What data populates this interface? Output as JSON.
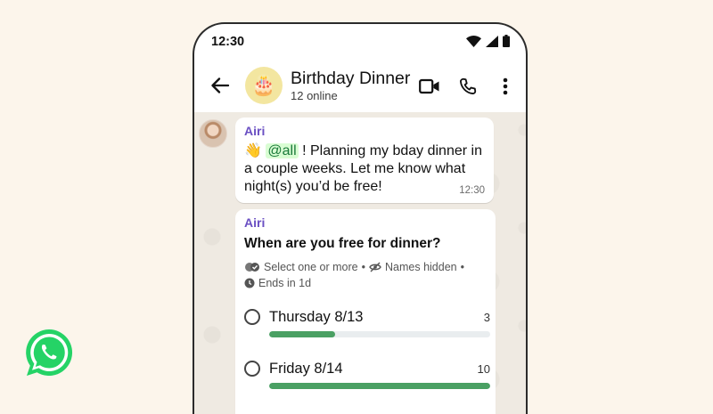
{
  "status_bar": {
    "time": "12:30"
  },
  "header": {
    "chat_title": "Birthday Dinner",
    "subtitle": "12 online",
    "avatar_emoji": "🎂"
  },
  "messages": [
    {
      "sender": "Airi",
      "emoji": "👋",
      "mention": "@all",
      "text": "! Planning my bday dinner in a couple weeks. Let me know what night(s) you’d be free!",
      "time": "12:30"
    }
  ],
  "poll": {
    "sender": "Airi",
    "question": "When are you free for dinner?",
    "meta_select": "Select one or more",
    "meta_names": "Names hidden",
    "meta_ends": "Ends in 1d",
    "max_votes": 10,
    "options": [
      {
        "label": "Thursday 8/13",
        "count": 3
      },
      {
        "label": "Friday 8/14",
        "count": 10
      }
    ]
  },
  "colors": {
    "brand_green": "#25d366",
    "bar_green": "#4aa063",
    "sender_purple": "#6a4fc3",
    "background": "#fcf5eb"
  },
  "icons": [
    "whatsapp-logo-icon",
    "wifi-icon",
    "signal-icon",
    "battery-icon",
    "back-arrow-icon",
    "video-call-icon",
    "phone-call-icon",
    "more-options-icon",
    "double-check-icon",
    "eye-off-icon",
    "clock-icon"
  ]
}
